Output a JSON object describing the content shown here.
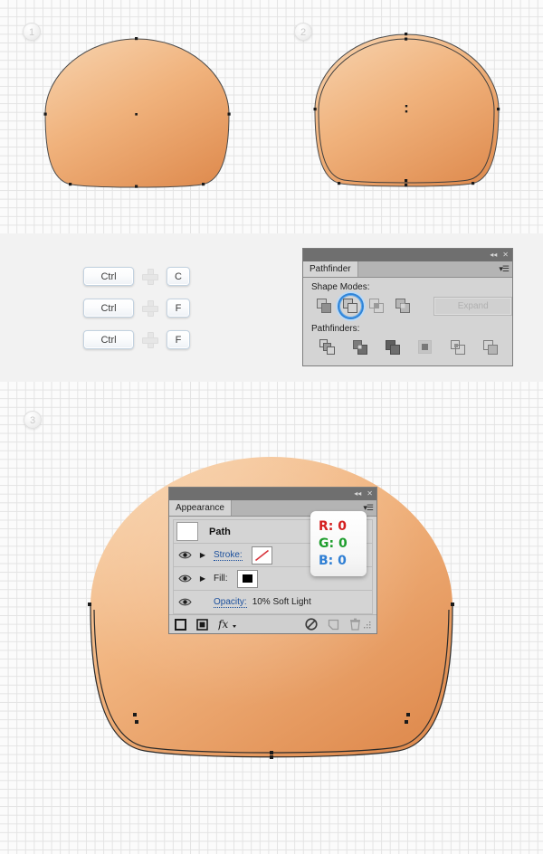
{
  "steps": [
    {
      "number": "1"
    },
    {
      "number": "2"
    },
    {
      "number": "3"
    }
  ],
  "shortcuts": {
    "rows": [
      {
        "modifier": "Ctrl",
        "plus": "+",
        "key": "C"
      },
      {
        "modifier": "Ctrl",
        "plus": "+",
        "key": "F"
      },
      {
        "modifier": "Ctrl",
        "plus": "+",
        "key": "F"
      }
    ]
  },
  "pathfinder": {
    "tab_label": "Pathfinder",
    "collapse_icon": "◂◂",
    "close_icon": "✕",
    "menu_icon": "▾☰",
    "shape_modes_label": "Shape Modes:",
    "pathfinders_label": "Pathfinders:",
    "expand_label": "Expand",
    "shape_modes": [
      {
        "name": "unite",
        "selected": false
      },
      {
        "name": "minus-front",
        "selected": true
      },
      {
        "name": "intersect",
        "selected": false
      },
      {
        "name": "exclude",
        "selected": false
      }
    ],
    "pathfinder_ops": [
      {
        "name": "divide"
      },
      {
        "name": "trim"
      },
      {
        "name": "merge"
      },
      {
        "name": "crop"
      },
      {
        "name": "outline"
      },
      {
        "name": "minus-back"
      }
    ]
  },
  "appearance": {
    "tab_label": "Appearance",
    "collapse_icon": "◂◂",
    "close_icon": "✕",
    "menu_icon": "▾☰",
    "path_label": "Path",
    "stroke_label": "Stroke:",
    "fill_label": "Fill:",
    "opacity_label": "Opacity:",
    "opacity_value": "10% Soft Light",
    "footer_icons": [
      {
        "name": "add-new-stroke"
      },
      {
        "name": "add-new-fill"
      },
      {
        "name": "add-new-effect"
      },
      {
        "name": "clear-appearance"
      },
      {
        "name": "duplicate-item"
      },
      {
        "name": "delete-item"
      }
    ]
  },
  "rgb_tooltip": {
    "lines": [
      {
        "label": "R: 0",
        "color": "#d41f1f"
      },
      {
        "label": "G: 0",
        "color": "#1f9e2e"
      },
      {
        "label": "B: 0",
        "color": "#2f7fd4"
      }
    ]
  },
  "artwork": {
    "shape1_name": "dome-shape-original",
    "shape2_name": "dome-shape-duplicated",
    "shape3_name": "dome-shape-shaded",
    "fill_light": "#f3c79c",
    "fill_mid": "#eeaa70",
    "fill_dark": "#e2894a",
    "stroke": "#3a3a3a"
  }
}
